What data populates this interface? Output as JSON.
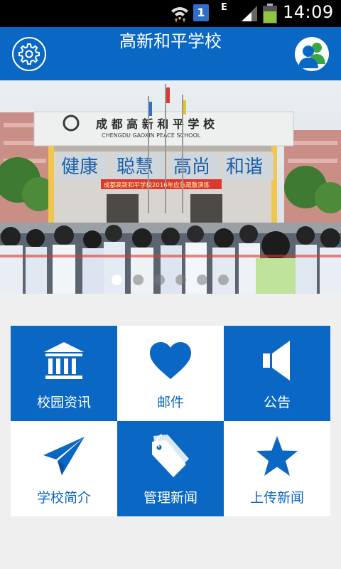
{
  "status_bar": {
    "time": "14:09",
    "badge": "1",
    "network": "E"
  },
  "header": {
    "title": "高新和平学校"
  },
  "banner": {
    "school_name_cn": "成 都 高 新 和 平 学 校",
    "school_name_en": "CHENGDU  GAOXIN  PEACE  SCHOOL",
    "motto": [
      "健康",
      "聪慧",
      "高尚",
      "和谐"
    ],
    "event_banner": "成都高新和平学校2016年应急疏散演练",
    "active_slide": 0,
    "slide_count": 6
  },
  "menu": [
    {
      "label": "校园资讯",
      "icon": "bank-icon"
    },
    {
      "label": "邮件",
      "icon": "heart-icon"
    },
    {
      "label": "公告",
      "icon": "speaker-icon"
    },
    {
      "label": "学校简介",
      "icon": "paper-plane-icon"
    },
    {
      "label": "管理新闻",
      "icon": "tag-icon"
    },
    {
      "label": "上传新闻",
      "icon": "star-icon"
    }
  ],
  "colors": {
    "primary": "#0a67c4",
    "background": "#efefef"
  }
}
